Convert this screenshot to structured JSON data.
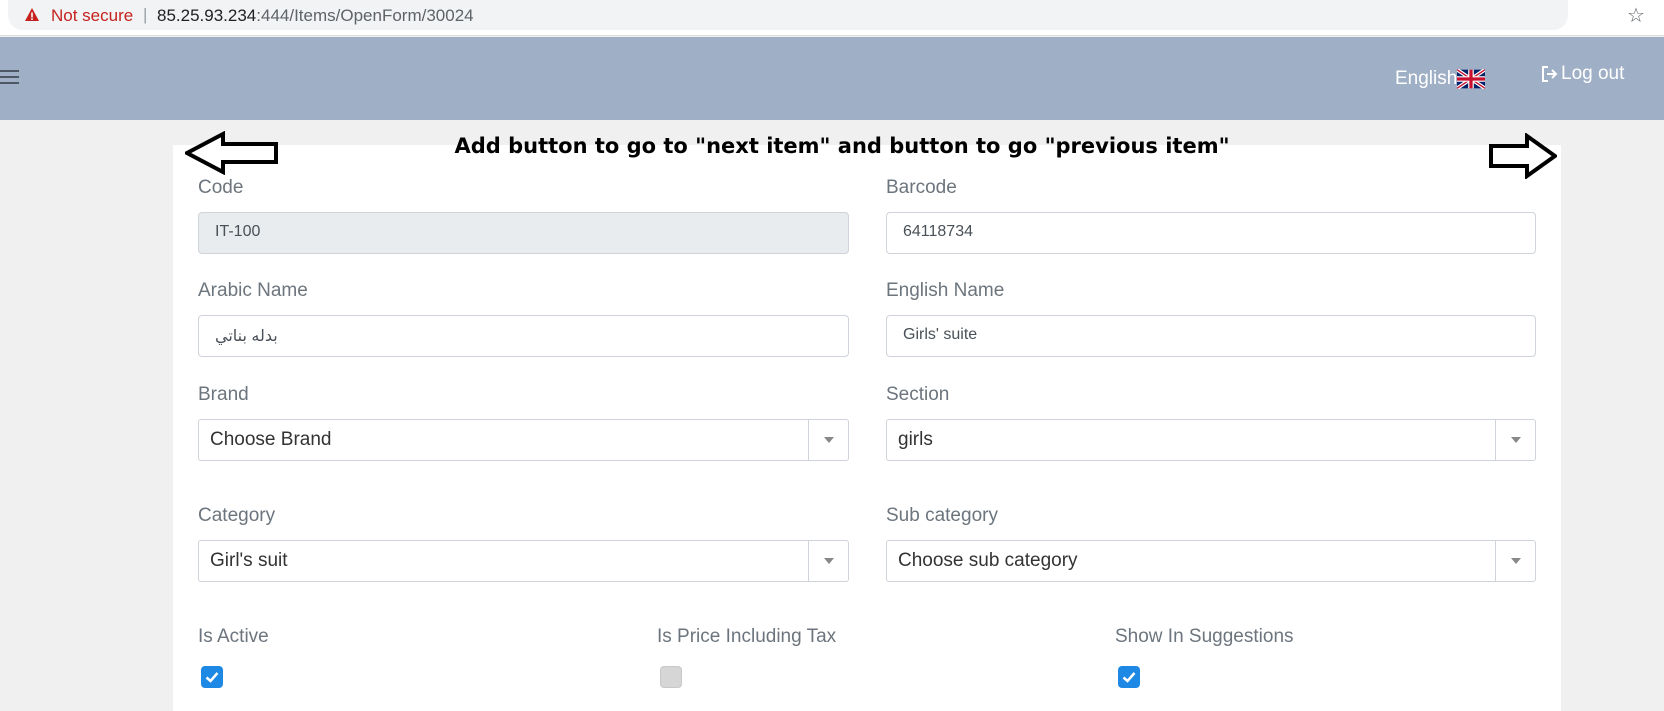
{
  "browser": {
    "security_label": "Not secure",
    "separator": "|",
    "url_host": "85.25.93.234",
    "url_path": ":444/Items/OpenForm/30024"
  },
  "navbar": {
    "language_label": "English",
    "logout_label": "Log out"
  },
  "annotation": {
    "text": "Add button to go to \"next item\" and button to go \"previous item\""
  },
  "form": {
    "code": {
      "label": "Code",
      "value": "IT-100"
    },
    "barcode": {
      "label": "Barcode",
      "value": "64118734"
    },
    "arabic_name": {
      "label": "Arabic Name",
      "value": "بدله بناتي"
    },
    "english_name": {
      "label": "English Name",
      "value": "Girls' suite"
    },
    "brand": {
      "label": "Brand",
      "value": "Choose Brand"
    },
    "section": {
      "label": "Section",
      "value": "girls"
    },
    "category": {
      "label": "Category",
      "value": "Girl's suit"
    },
    "sub_category": {
      "label": "Sub category",
      "value": "Choose sub category"
    },
    "is_active": {
      "label": "Is Active",
      "checked": true
    },
    "is_price_including_tax": {
      "label": "Is Price Including Tax",
      "checked": false
    },
    "show_in_suggestions": {
      "label": "Show In Suggestions",
      "checked": true
    }
  },
  "colors": {
    "navbar_bg": "#9fafc6",
    "checkbox_on": "#1e88e5",
    "warning_red": "#c5221f"
  },
  "icons": [
    "warning-icon",
    "star-icon",
    "hamburger-icon",
    "uk-flag-icon",
    "logout-icon",
    "left-arrow-icon",
    "right-arrow-icon",
    "dropdown-caret-icon",
    "checkmark-icon"
  ]
}
